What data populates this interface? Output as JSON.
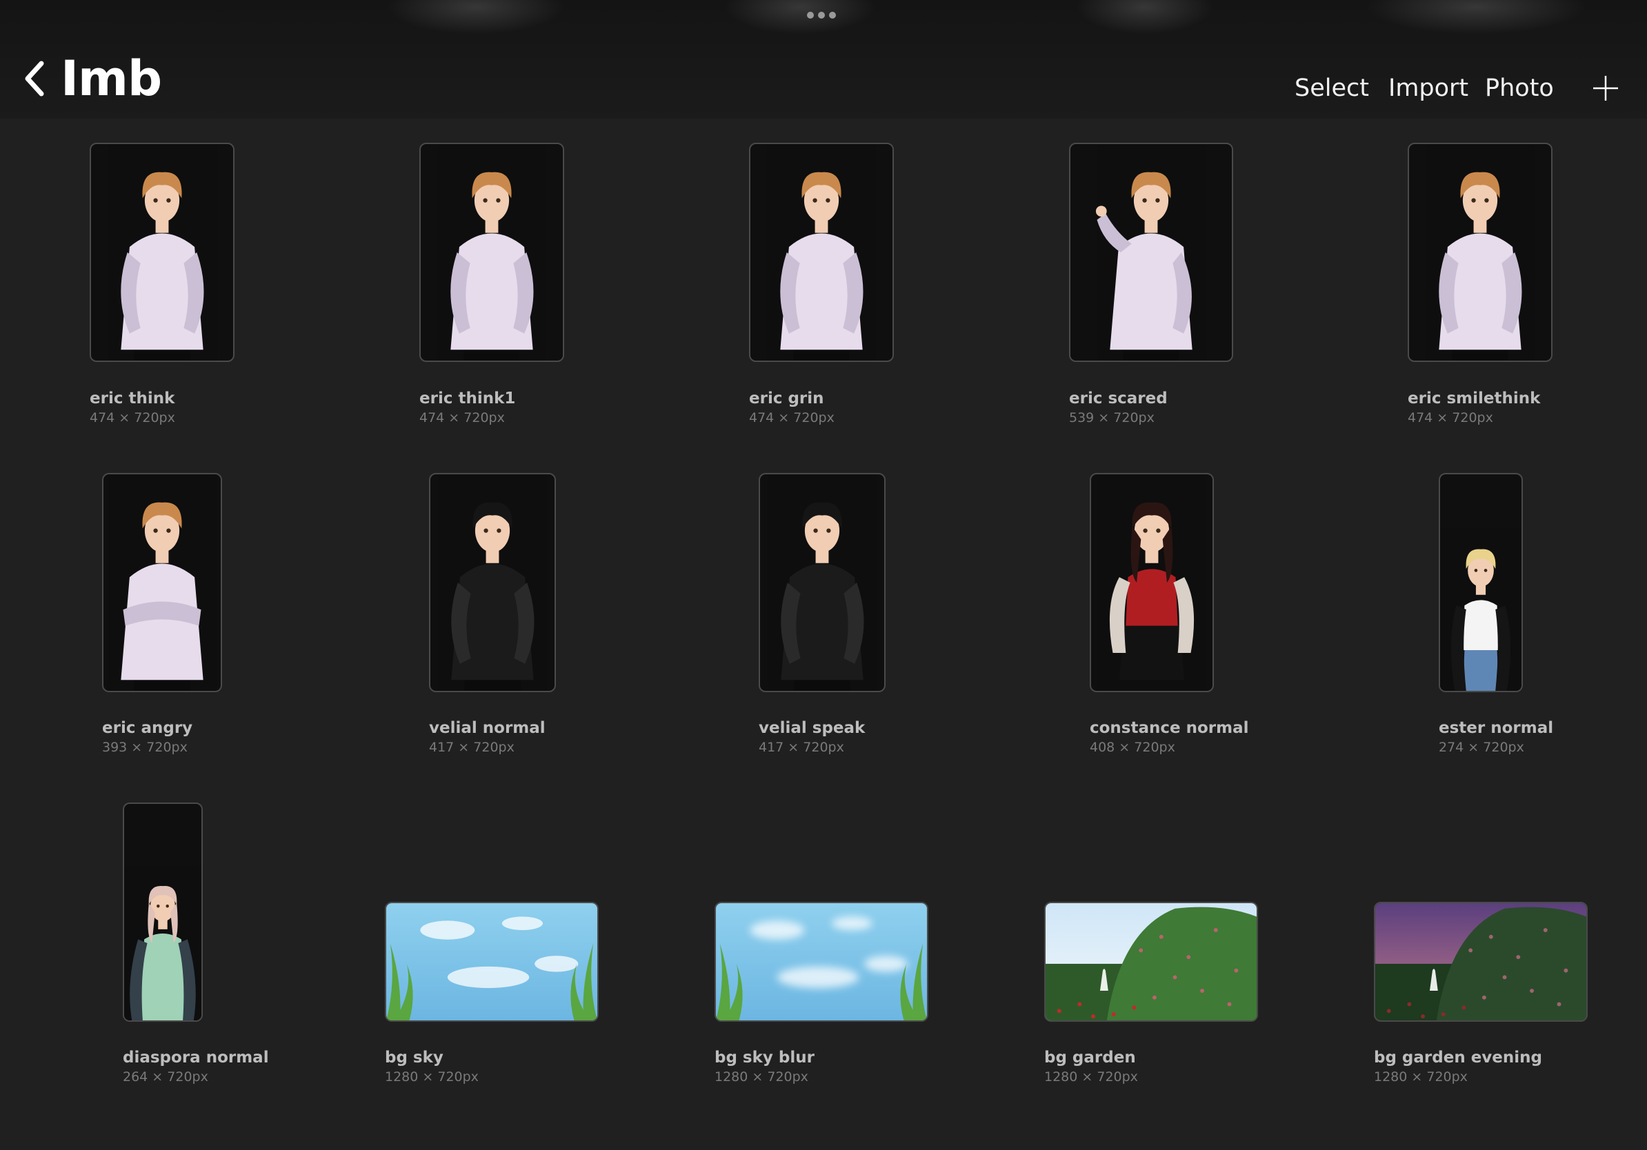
{
  "header": {
    "title": "Imb",
    "select_label": "Select",
    "import_label": "Import",
    "photo_label": "Photo"
  },
  "items": [
    {
      "name": "eric think",
      "dims": "474 × 720px",
      "art": "eric-think"
    },
    {
      "name": "eric think1",
      "dims": "474 × 720px",
      "art": "eric-think"
    },
    {
      "name": "eric grin",
      "dims": "474 × 720px",
      "art": "eric-think"
    },
    {
      "name": "eric scared",
      "dims": "539 × 720px",
      "art": "eric-scared"
    },
    {
      "name": "eric smilethink",
      "dims": "474 × 720px",
      "art": "eric-think"
    },
    {
      "name": "eric angry",
      "dims": "393 × 720px",
      "art": "eric-angry"
    },
    {
      "name": "velial normal",
      "dims": "417 × 720px",
      "art": "velial"
    },
    {
      "name": "velial speak",
      "dims": "417 × 720px",
      "art": "velial"
    },
    {
      "name": "constance normal",
      "dims": "408 × 720px",
      "art": "constance"
    },
    {
      "name": "ester normal",
      "dims": "274 × 720px",
      "art": "ester"
    },
    {
      "name": "diaspora normal",
      "dims": "264 × 720px",
      "art": "diaspora"
    },
    {
      "name": "bg sky",
      "dims": "1280 × 720px",
      "art": "sky"
    },
    {
      "name": "bg sky blur",
      "dims": "1280 × 720px",
      "art": "sky-blur"
    },
    {
      "name": "bg garden",
      "dims": "1280 × 720px",
      "art": "garden"
    },
    {
      "name": "bg garden evening",
      "dims": "1280 × 720px",
      "art": "garden-evening"
    }
  ]
}
